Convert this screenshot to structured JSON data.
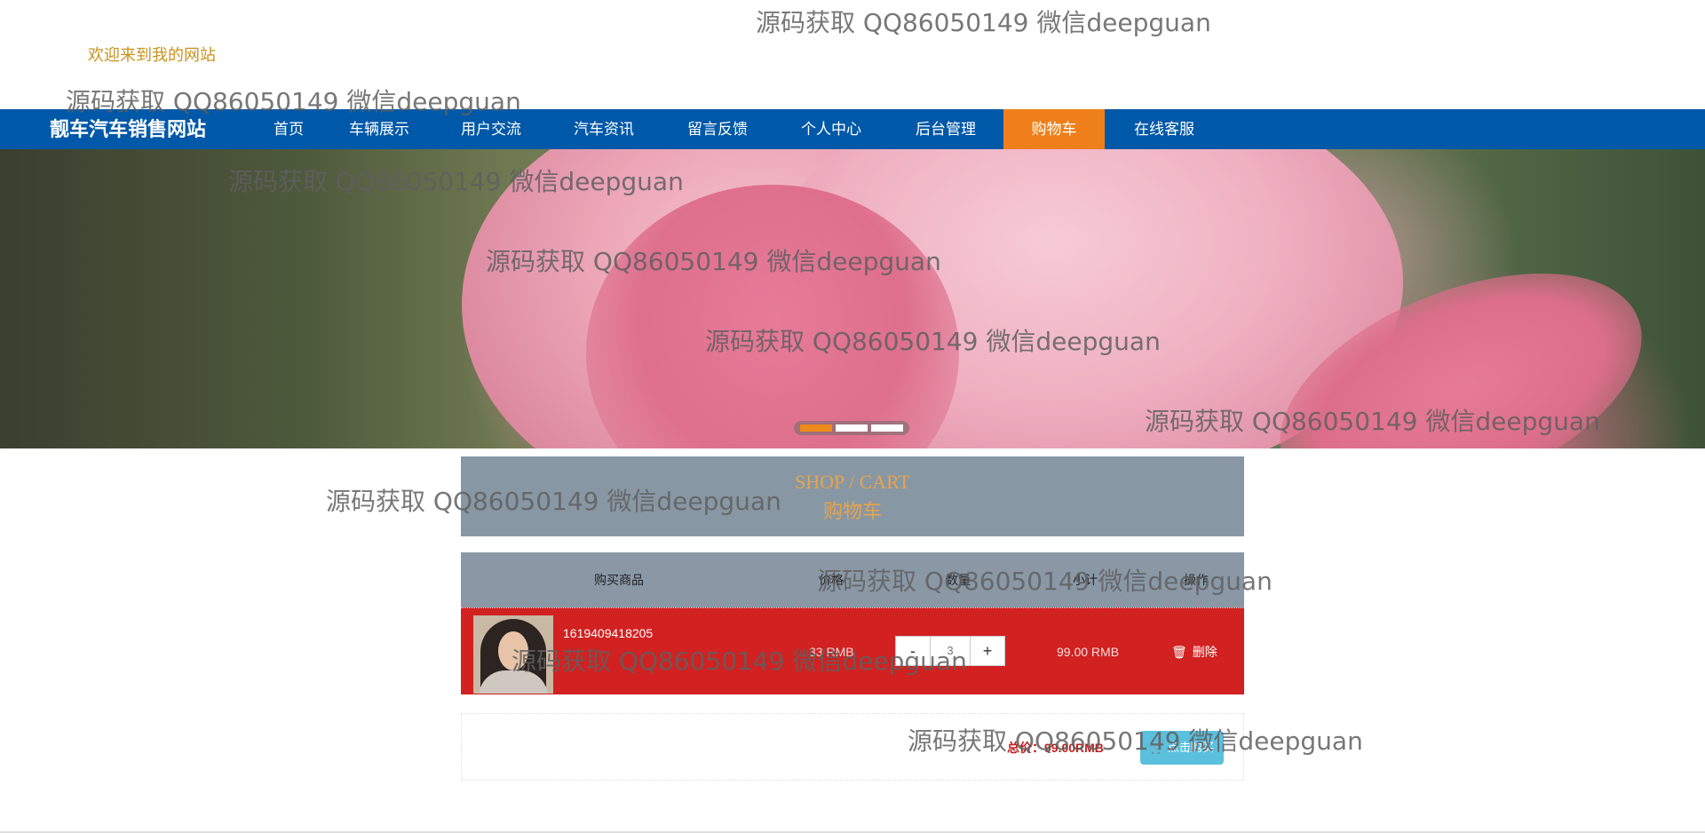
{
  "header": {
    "welcome": "欢迎来到我的网站"
  },
  "navbar": {
    "brand": "靓车汽车销售网站",
    "items": [
      {
        "label": "首页"
      },
      {
        "label": "车辆展示"
      },
      {
        "label": "用户交流"
      },
      {
        "label": "汽车资讯"
      },
      {
        "label": "留言反馈"
      },
      {
        "label": "个人中心"
      },
      {
        "label": "后台管理"
      },
      {
        "label": "购物车",
        "active": true
      },
      {
        "label": "在线客服"
      }
    ]
  },
  "banner": {
    "slides": 3,
    "active_slide": 1
  },
  "cart": {
    "title_en": "SHOP / CART",
    "title_cn": "购物车",
    "columns": [
      "购买商品",
      "价格",
      "数量",
      "小计",
      "操作"
    ],
    "items": [
      {
        "name": "1619409418205",
        "price": "33 RMB",
        "quantity": "3",
        "minus": "-",
        "plus": "+",
        "subtotal": "99.00 RMB",
        "delete_label": "删除"
      }
    ],
    "total": "总价：99.00RMB",
    "checkout_label": "点击购买"
  },
  "watermark": "源码获取 QQ86050149 微信deepguan",
  "colors": {
    "nav_bg": "#0058a8",
    "nav_active": "#ef7f1a",
    "row_bg": "#d12121",
    "checkout": "#5bc0de"
  }
}
